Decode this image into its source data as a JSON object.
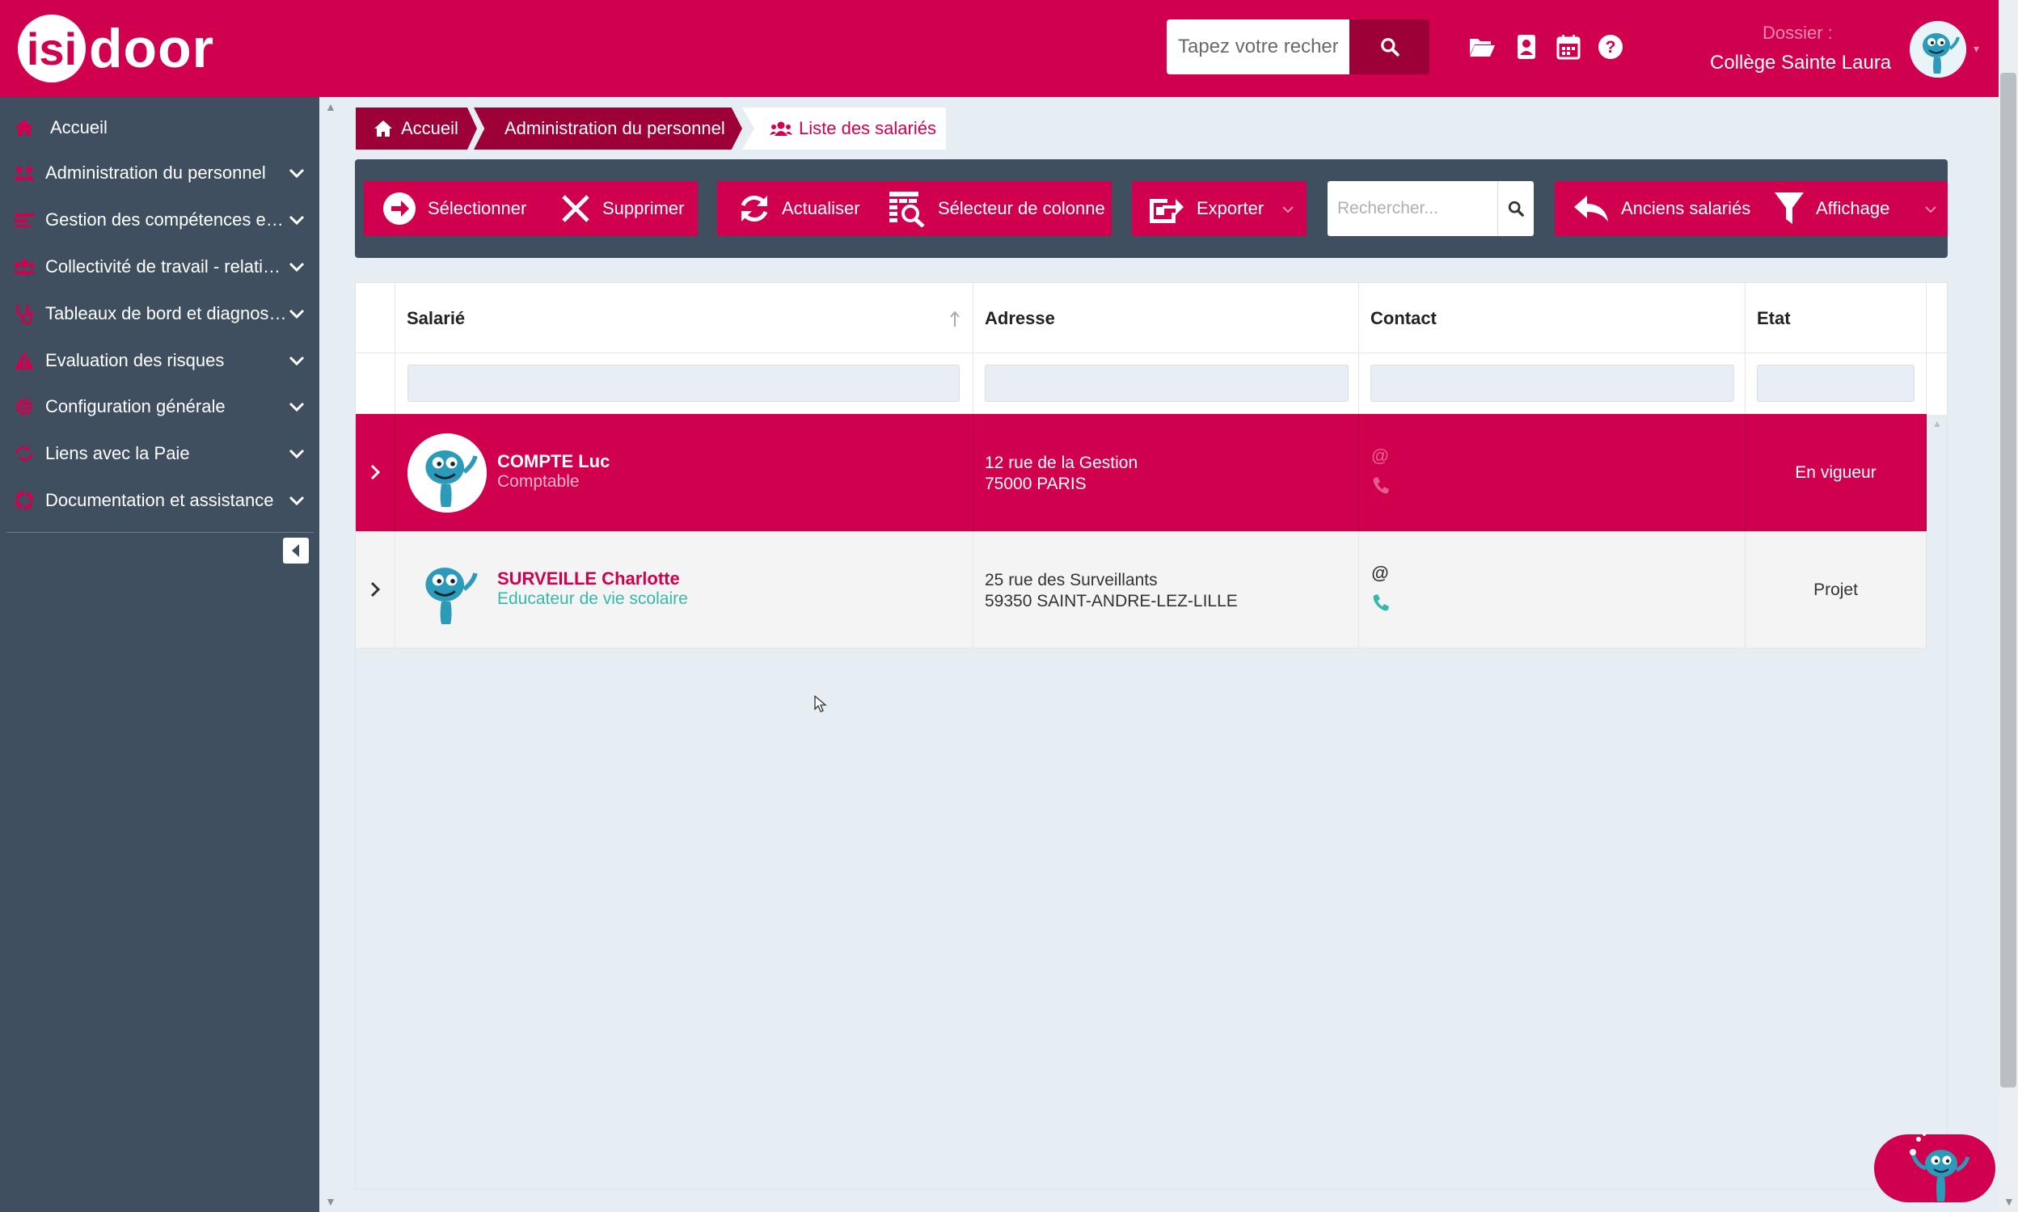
{
  "header": {
    "logo_badge": "isi",
    "logo_text": "door",
    "search_placeholder": "Tapez votre recherche",
    "dossier_label": "Dossier :",
    "dossier_name": "Collège Sainte Laura",
    "icons": [
      "folder-open-icon",
      "address-book-icon",
      "calendar-icon",
      "help-icon"
    ]
  },
  "sidebar": {
    "items": [
      {
        "label": "Accueil",
        "icon": "home-icon"
      },
      {
        "label": "Administration du personnel",
        "icon": "users-icon"
      },
      {
        "label": "Gestion des compétences et des formations",
        "icon": "skills-icon"
      },
      {
        "label": "Collectivité de travail - relations sociales",
        "icon": "group-icon"
      },
      {
        "label": "Tableaux de bord et diagnostics",
        "icon": "stethoscope-icon"
      },
      {
        "label": "Evaluation des risques",
        "icon": "warning-icon"
      },
      {
        "label": "Configuration générale",
        "icon": "cog-icon"
      },
      {
        "label": "Liens avec la Paie",
        "icon": "link-icon"
      },
      {
        "label": "Documentation et assistance",
        "icon": "lifebuoy-icon"
      }
    ]
  },
  "breadcrumb": {
    "home": "Accueil",
    "admin": "Administration du personnel",
    "current": "Liste des salariés"
  },
  "toolbar": {
    "select": "Sélectionner",
    "delete": "Supprimer",
    "refresh": "Actualiser",
    "columns": "Sélecteur de colonne",
    "export": "Exporter",
    "search_placeholder": "Rechercher...",
    "former": "Anciens salariés",
    "display": "Affichage"
  },
  "table": {
    "columns": [
      "Salarié",
      "Adresse",
      "Contact",
      "Etat"
    ],
    "rows": [
      {
        "name": "COMPTE Luc",
        "role": "Comptable",
        "address_line1": "12 rue de la Gestion",
        "address_line2": "75000 PARIS",
        "state": "En vigueur",
        "selected": true
      },
      {
        "name": "SURVEILLE Charlotte",
        "role": "Educateur de vie scolaire",
        "address_line1": "25 rue des Surveillants",
        "address_line2": "59350 SAINT-ANDRE-LEZ-LILLE",
        "state": "Projet",
        "selected": false
      }
    ]
  },
  "colors": {
    "brand": "#d1004f",
    "brand_dark": "#9c0037",
    "sidebar": "#3f4f5f",
    "accent_teal": "#35b9a9"
  }
}
